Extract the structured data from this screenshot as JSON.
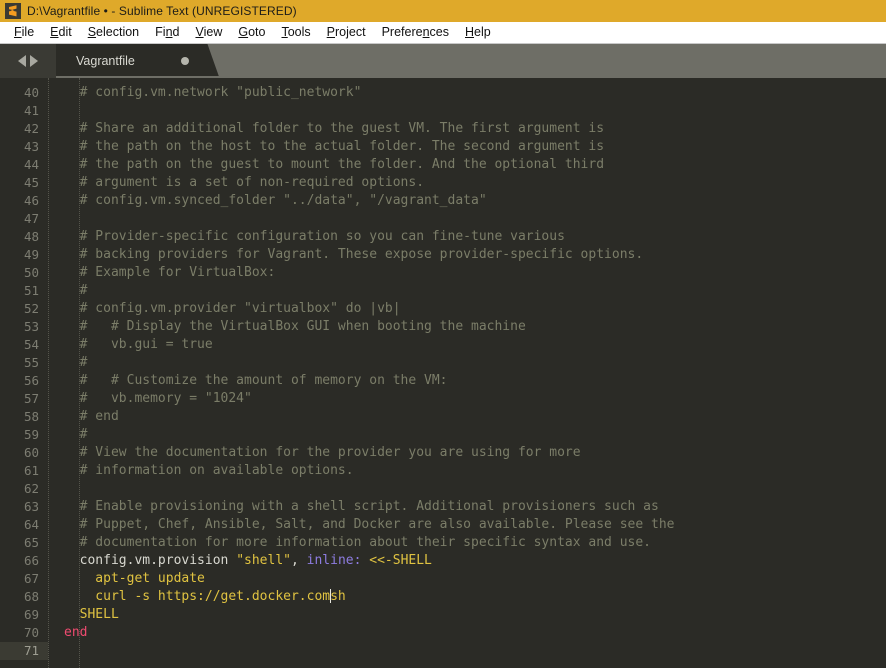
{
  "window": {
    "title": "D:\\Vagrantfile • - Sublime Text (UNREGISTERED)",
    "icon": "sublime-text-logo-icon",
    "titlebar_color": "#dfa92a"
  },
  "menubar": {
    "items": [
      {
        "label": "File",
        "mnemonic_index": 0
      },
      {
        "label": "Edit",
        "mnemonic_index": 0
      },
      {
        "label": "Selection",
        "mnemonic_index": 0
      },
      {
        "label": "Find",
        "mnemonic_index": 2
      },
      {
        "label": "View",
        "mnemonic_index": 0
      },
      {
        "label": "Goto",
        "mnemonic_index": 0
      },
      {
        "label": "Tools",
        "mnemonic_index": 0
      },
      {
        "label": "Project",
        "mnemonic_index": 0
      },
      {
        "label": "Preferences",
        "mnemonic_index": 8
      },
      {
        "label": "Help",
        "mnemonic_index": 0
      }
    ]
  },
  "tabbar": {
    "nav_prev_icon": "arrow-left-icon",
    "nav_next_icon": "arrow-right-icon",
    "tabs": [
      {
        "label": "Vagrantfile",
        "dirty": true,
        "active": true
      }
    ]
  },
  "editor": {
    "first_line_number": 40,
    "active_line_number": 71,
    "colors": {
      "background": "#2b2b26",
      "gutter_text": "#7d7d72",
      "comment": "#7b7d68",
      "string": "#e0c341",
      "symbol": "#8d7ce0",
      "keyword": "#ef4b70",
      "plain": "#d8d8d0"
    },
    "lines": [
      {
        "n": 40,
        "tokens": [
          {
            "t": "  # config.vm.network \"public_network\"",
            "c": "cm"
          }
        ]
      },
      {
        "n": 41,
        "tokens": []
      },
      {
        "n": 42,
        "tokens": [
          {
            "t": "  # Share an additional folder to the guest VM. The first argument is",
            "c": "cm"
          }
        ]
      },
      {
        "n": 43,
        "tokens": [
          {
            "t": "  # the path on the host to the actual folder. The second argument is",
            "c": "cm"
          }
        ]
      },
      {
        "n": 44,
        "tokens": [
          {
            "t": "  # the path on the guest to mount the folder. And the optional third",
            "c": "cm"
          }
        ]
      },
      {
        "n": 45,
        "tokens": [
          {
            "t": "  # argument is a set of non-required options.",
            "c": "cm"
          }
        ]
      },
      {
        "n": 46,
        "tokens": [
          {
            "t": "  # config.vm.synced_folder \"../data\", \"/vagrant_data\"",
            "c": "cm"
          }
        ]
      },
      {
        "n": 47,
        "tokens": []
      },
      {
        "n": 48,
        "tokens": [
          {
            "t": "  # Provider-specific configuration so you can fine-tune various",
            "c": "cm"
          }
        ]
      },
      {
        "n": 49,
        "tokens": [
          {
            "t": "  # backing providers for Vagrant. These expose provider-specific options.",
            "c": "cm"
          }
        ]
      },
      {
        "n": 50,
        "tokens": [
          {
            "t": "  # Example for VirtualBox:",
            "c": "cm"
          }
        ]
      },
      {
        "n": 51,
        "tokens": [
          {
            "t": "  #",
            "c": "cm"
          }
        ]
      },
      {
        "n": 52,
        "tokens": [
          {
            "t": "  # config.vm.provider \"virtualbox\" do |vb|",
            "c": "cm"
          }
        ]
      },
      {
        "n": 53,
        "tokens": [
          {
            "t": "  #   # Display the VirtualBox GUI when booting the machine",
            "c": "cm"
          }
        ]
      },
      {
        "n": 54,
        "tokens": [
          {
            "t": "  #   vb.gui = true",
            "c": "cm"
          }
        ]
      },
      {
        "n": 55,
        "tokens": [
          {
            "t": "  #",
            "c": "cm"
          }
        ]
      },
      {
        "n": 56,
        "tokens": [
          {
            "t": "  #   # Customize the amount of memory on the VM:",
            "c": "cm"
          }
        ]
      },
      {
        "n": 57,
        "tokens": [
          {
            "t": "  #   vb.memory = \"1024\"",
            "c": "cm"
          }
        ]
      },
      {
        "n": 58,
        "tokens": [
          {
            "t": "  # end",
            "c": "cm"
          }
        ]
      },
      {
        "n": 59,
        "tokens": [
          {
            "t": "  #",
            "c": "cm"
          }
        ]
      },
      {
        "n": 60,
        "tokens": [
          {
            "t": "  # View the documentation for the provider you are using for more",
            "c": "cm"
          }
        ]
      },
      {
        "n": 61,
        "tokens": [
          {
            "t": "  # information on available options.",
            "c": "cm"
          }
        ]
      },
      {
        "n": 62,
        "tokens": []
      },
      {
        "n": 63,
        "tokens": [
          {
            "t": "  # Enable provisioning with a shell script. Additional provisioners such as",
            "c": "cm"
          }
        ]
      },
      {
        "n": 64,
        "tokens": [
          {
            "t": "  # Puppet, Chef, Ansible, Salt, and Docker are also available. Please see the",
            "c": "cm"
          }
        ]
      },
      {
        "n": 65,
        "tokens": [
          {
            "t": "  # documentation for more information about their specific syntax and use.",
            "c": "cm"
          }
        ]
      },
      {
        "n": 66,
        "tokens": [
          {
            "t": "  config.vm.provision ",
            "c": "pn"
          },
          {
            "t": "\"shell\"",
            "c": "st"
          },
          {
            "t": ", ",
            "c": "pn"
          },
          {
            "t": "inline:",
            "c": "pl"
          },
          {
            "t": " ",
            "c": "pn"
          },
          {
            "t": "<<-SHELL",
            "c": "st"
          }
        ]
      },
      {
        "n": 67,
        "tokens": [
          {
            "t": "    apt-get update",
            "c": "st"
          }
        ]
      },
      {
        "n": 68,
        "tokens": [
          {
            "t": "    curl -s https://get.docker.com",
            "c": "st"
          },
          {
            "t": "|CARET|",
            "c": "caret"
          },
          {
            "t": "sh",
            "c": "st"
          }
        ]
      },
      {
        "n": 69,
        "tokens": [
          {
            "t": "  SHELL",
            "c": "st"
          }
        ]
      },
      {
        "n": 70,
        "tokens": [
          {
            "t": "end",
            "c": "kw"
          }
        ]
      },
      {
        "n": 71,
        "tokens": []
      }
    ]
  }
}
